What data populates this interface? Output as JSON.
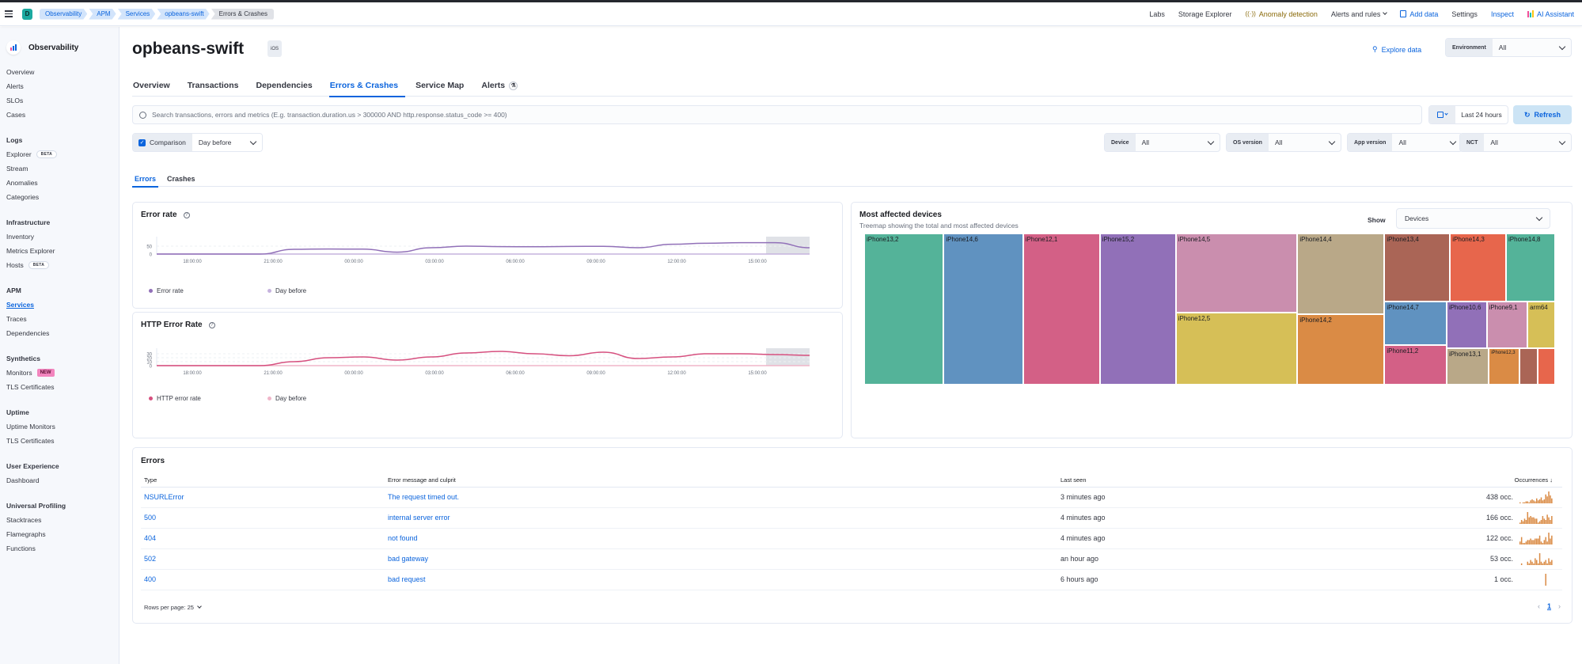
{
  "header": {
    "space_initial": "D",
    "breadcrumbs": [
      "Observability",
      "APM",
      "Services",
      "opbeans-swift",
      "Errors & Crashes"
    ],
    "links": {
      "labs": "Labs",
      "storage_explorer": "Storage Explorer",
      "anomaly_detection": "Anomaly detection",
      "alerts_and_rules": "Alerts and rules",
      "add_data": "Add data",
      "settings": "Settings",
      "inspect": "Inspect",
      "ai_assistant": "AI Assistant"
    }
  },
  "sidebar": {
    "brand": "Observability",
    "top_items": [
      "Overview",
      "Alerts",
      "SLOs",
      "Cases"
    ],
    "groups": [
      {
        "title": "Logs",
        "items": [
          {
            "label": "Explorer",
            "badge": "BETA"
          },
          {
            "label": "Stream"
          },
          {
            "label": "Anomalies"
          },
          {
            "label": "Categories"
          }
        ]
      },
      {
        "title": "Infrastructure",
        "items": [
          {
            "label": "Inventory"
          },
          {
            "label": "Metrics Explorer"
          },
          {
            "label": "Hosts",
            "badge": "BETA"
          }
        ]
      },
      {
        "title": "APM",
        "items": [
          {
            "label": "Services",
            "active": true
          },
          {
            "label": "Traces"
          },
          {
            "label": "Dependencies"
          }
        ]
      },
      {
        "title": "Synthetics",
        "items": [
          {
            "label": "Monitors",
            "badge_new": "NEW"
          },
          {
            "label": "TLS Certificates"
          }
        ]
      },
      {
        "title": "Uptime",
        "items": [
          {
            "label": "Uptime Monitors"
          },
          {
            "label": "TLS Certificates"
          }
        ]
      },
      {
        "title": "User Experience",
        "items": [
          {
            "label": "Dashboard"
          }
        ]
      },
      {
        "title": "Universal Profiling",
        "items": [
          {
            "label": "Stacktraces"
          },
          {
            "label": "Flamegraphs"
          },
          {
            "label": "Functions"
          }
        ]
      }
    ]
  },
  "page": {
    "title": "opbeans-swift",
    "os_badge": "iOS",
    "explore_data": "Explore data",
    "environment": {
      "label": "Environment",
      "value": "All"
    },
    "tabs": [
      "Overview",
      "Transactions",
      "Dependencies",
      "Errors & Crashes",
      "Service Map",
      "Alerts"
    ],
    "active_tab": "Errors & Crashes",
    "search_placeholder": "Search transactions, errors and metrics (E.g. transaction.duration.us > 300000 AND http.response.status_code >= 400)",
    "date_range": "Last 24 hours",
    "refresh_label": "Refresh",
    "comparison": {
      "label": "Comparison",
      "checked": true,
      "value": "Day before"
    },
    "filters": [
      {
        "label": "Device",
        "value": "All"
      },
      {
        "label": "OS version",
        "value": "All"
      },
      {
        "label": "App version",
        "value": "All"
      },
      {
        "label": "NCT",
        "value": "All"
      }
    ],
    "subtabs": [
      "Errors",
      "Crashes"
    ],
    "active_subtab": "Errors"
  },
  "chart_data": [
    {
      "type": "line",
      "title": "Error rate",
      "x": [
        "16:30",
        "18:00",
        "19:30",
        "20:00",
        "21:00",
        "22:30",
        "23:00",
        "00:30",
        "02:00",
        "03:00",
        "04:00",
        "06:00",
        "07:30",
        "09:00",
        "10:30",
        "12:00",
        "13:30",
        "15:00",
        "16:00",
        "17:00"
      ],
      "xticks": [
        "18:00:00",
        "21:00:00",
        "00:00:00",
        "03:00:00",
        "06:00:00",
        "09:00:00",
        "12:00:00",
        "15:00:00"
      ],
      "yticks": [
        "0",
        "50"
      ],
      "ylim": [
        0,
        100
      ],
      "series": [
        {
          "name": "Error rate",
          "color": "#9170b8",
          "values": [
            0,
            0,
            0,
            0,
            30,
            32,
            31,
            12,
            40,
            50,
            47,
            46,
            48,
            49,
            40,
            62,
            68,
            72,
            72,
            40
          ]
        },
        {
          "name": "Day before",
          "color": "#c6b3de",
          "values": [
            0,
            0,
            0,
            0,
            0,
            0,
            0,
            0,
            0,
            0,
            0,
            0,
            0,
            0,
            0,
            0,
            0,
            0,
            0,
            0
          ]
        }
      ],
      "shaded_region": "last ~1.5 hours (incomplete bucket)"
    },
    {
      "type": "line",
      "title": "HTTP Error Rate",
      "x": [
        "16:30",
        "18:00",
        "19:30",
        "20:00",
        "21:00",
        "22:30",
        "23:00",
        "00:30",
        "02:00",
        "03:00",
        "04:00",
        "06:00",
        "07:30",
        "09:00",
        "10:30",
        "12:00",
        "13:30",
        "15:00",
        "16:00",
        "17:00"
      ],
      "xticks": [
        "18:00:00",
        "21:00:00",
        "00:00:00",
        "03:00:00",
        "06:00:00",
        "09:00:00",
        "12:00:00",
        "15:00:00"
      ],
      "yticks": [
        "0",
        "10",
        "20",
        "30"
      ],
      "ylim": [
        0,
        40
      ],
      "series": [
        {
          "name": "HTTP error rate",
          "color": "#d6507f",
          "values": [
            0,
            0,
            0,
            0,
            10,
            20,
            22,
            14,
            22,
            32,
            36,
            30,
            25,
            34,
            18,
            22,
            30,
            30,
            28,
            26
          ]
        },
        {
          "name": "Day before",
          "color": "#f0b6c9",
          "values": [
            0,
            0,
            0,
            0,
            0,
            0,
            0,
            0,
            0,
            0,
            0,
            0,
            0,
            0,
            0,
            0,
            0,
            0,
            0,
            0
          ]
        }
      ],
      "shaded_region": "last ~1.5 hours (incomplete bucket)"
    },
    {
      "type": "treemap",
      "title": "Most affected devices",
      "subtitle": "Treemap showing the total and most affected devices",
      "show_label": "Show",
      "show_value": "Devices",
      "items": [
        {
          "name": "iPhone13,2",
          "color": "#54b399",
          "share": 0.1
        },
        {
          "name": "iPhone14,6",
          "color": "#6092c0",
          "share": 0.1
        },
        {
          "name": "iPhone12,1",
          "color": "#d36086",
          "share": 0.1
        },
        {
          "name": "iPhone15,2",
          "color": "#9170b8",
          "share": 0.1
        },
        {
          "name": "iPhone14,5",
          "color": "#ca8eae",
          "share": 0.087
        },
        {
          "name": "iPhone12,5",
          "color": "#d6bf57",
          "share": 0.073
        },
        {
          "name": "iPhone14,4",
          "color": "#b9a888",
          "share": 0.065
        },
        {
          "name": "iPhone14,2",
          "color": "#da8b45",
          "share": 0.056
        },
        {
          "name": "iPhone13,4",
          "color": "#aa6556",
          "share": 0.046
        },
        {
          "name": "iPhone14,3",
          "color": "#e7664c",
          "share": 0.039
        },
        {
          "name": "iPhone14,8",
          "color": "#54b399",
          "share": 0.037
        },
        {
          "name": "iPhone14,7",
          "color": "#6092c0",
          "share": 0.025
        },
        {
          "name": "iPhone11,2",
          "color": "#d36086",
          "share": 0.021
        },
        {
          "name": "iPhone10,6",
          "color": "#9170b8",
          "share": 0.016
        },
        {
          "name": "iPhone9,1",
          "color": "#ca8eae",
          "share": 0.016
        },
        {
          "name": "arm64",
          "color": "#d6bf57",
          "share": 0.016
        },
        {
          "name": "iPhone13,1",
          "color": "#b9a888",
          "share": 0.012
        },
        {
          "name": "iPhone12,3",
          "color": "#da8b45",
          "share": 0.009
        },
        {
          "name": "",
          "color": "#aa6556",
          "share": 0.006
        },
        {
          "name": "",
          "color": "#e7664c",
          "share": 0.006
        }
      ]
    }
  ],
  "errors_table": {
    "title": "Errors",
    "columns": [
      "Type",
      "Error message and culprit",
      "Last seen",
      "Occurrences"
    ],
    "sort_indicator": "↓",
    "rows": [
      {
        "type": "NSURLError",
        "message": "The request timed out.",
        "last_seen": "3 minutes ago",
        "occurrences": "438 occ.",
        "spark": [
          1,
          0,
          1,
          1,
          2,
          2,
          1,
          3,
          4,
          3,
          2,
          5,
          3,
          4,
          6,
          3,
          4,
          9,
          7,
          12,
          8,
          5
        ]
      },
      {
        "type": "500",
        "message": "internal server error",
        "last_seen": "4 minutes ago",
        "occurrences": "166 occ.",
        "spark": [
          1,
          3,
          2,
          4,
          3,
          9,
          5,
          6,
          5,
          5,
          4,
          4,
          1,
          2,
          3,
          6,
          4,
          3,
          7,
          5,
          3,
          6
        ]
      },
      {
        "type": "404",
        "message": "not found",
        "last_seen": "4 minutes ago",
        "occurrences": "122 occ.",
        "spark": [
          2,
          5,
          1,
          1,
          2,
          3,
          3,
          4,
          3,
          3,
          4,
          4,
          4,
          6,
          2,
          1,
          3,
          5,
          2,
          8,
          4,
          6
        ]
      },
      {
        "type": "502",
        "message": "bad gateway",
        "last_seen": "an hour ago",
        "occurrences": "53 occ.",
        "spark": [
          0,
          1,
          0,
          0,
          0,
          2,
          1,
          3,
          2,
          1,
          4,
          3,
          1,
          7,
          2,
          1,
          2,
          3,
          1,
          4,
          2,
          3
        ]
      },
      {
        "type": "400",
        "message": "bad request",
        "last_seen": "6 hours ago",
        "occurrences": "1 occ.",
        "spark": [
          0,
          0,
          0,
          0,
          0,
          0,
          0,
          0,
          0,
          0,
          0,
          0,
          0,
          0,
          0,
          0,
          0,
          10,
          0,
          0,
          0,
          0
        ]
      }
    ],
    "rows_per_page": "Rows per page: 25",
    "current_page": "1"
  }
}
